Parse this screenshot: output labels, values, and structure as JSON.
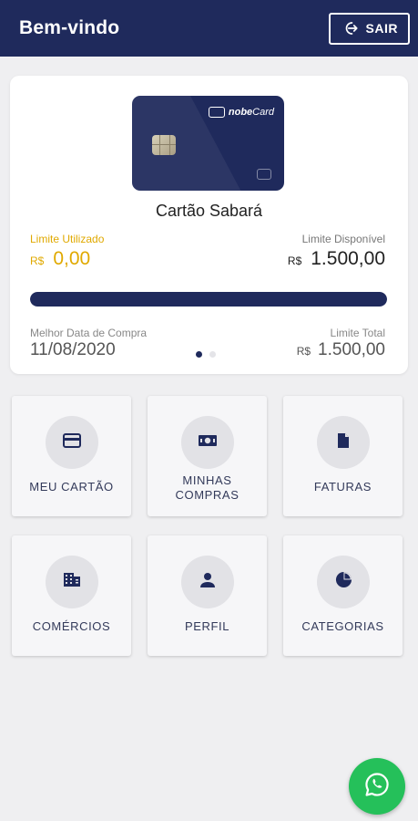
{
  "header": {
    "title": "Bem-vindo",
    "logout_label": "SAIR"
  },
  "card": {
    "brand_prefix": "nobe",
    "brand_suffix": "Card",
    "name": "Cartão Sabará",
    "limit_used_label": "Limite Utilizado",
    "limit_used_currency": "R$",
    "limit_used_value": "0,00",
    "limit_available_label": "Limite Disponível",
    "limit_available_currency": "R$",
    "limit_available_value": "1.500,00",
    "available_fraction": 1.0,
    "best_purchase_date_label": "Melhor Data de Compra",
    "best_purchase_date": "11/08/2020",
    "total_limit_label": "Limite Total",
    "total_limit_currency": "R$",
    "total_limit_value": "1.500,00",
    "carousel_pages": 2,
    "carousel_active": 1
  },
  "menu": {
    "my_card": "MEU CARTÃO",
    "my_purchases_line1": "MINHAS",
    "my_purchases_line2": "COMPRAS",
    "invoices": "FATURAS",
    "stores": "COMÉRCIOS",
    "profile": "PERFIL",
    "categories": "CATEGORIAS"
  },
  "icons": {
    "logout": "logout-icon",
    "my_card": "credit-card-icon",
    "my_purchases": "money-icon",
    "invoices": "document-icon",
    "stores": "building-icon",
    "profile": "person-icon",
    "categories": "pie-chart-icon",
    "fab": "whatsapp-icon"
  },
  "colors": {
    "primary": "#1f2a5c",
    "accent_used": "#e0a900",
    "whatsapp": "#25c05a",
    "background": "#efeff1"
  }
}
